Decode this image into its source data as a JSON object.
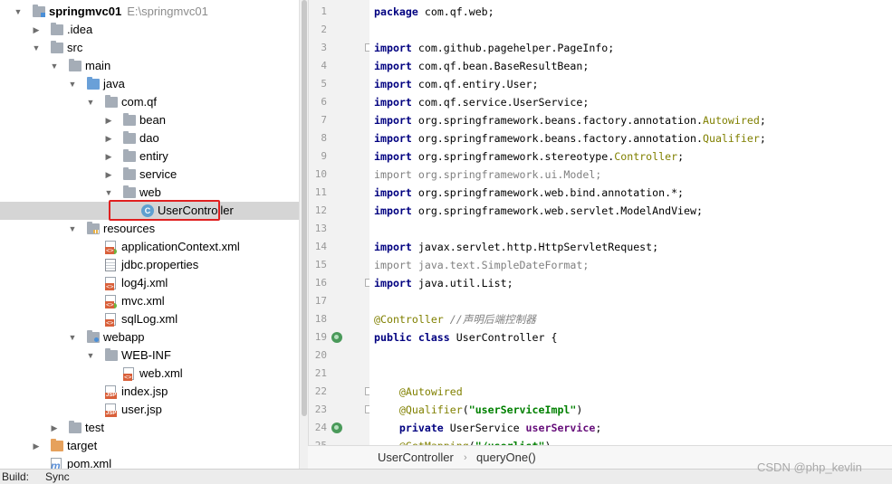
{
  "tree": {
    "rows": [
      {
        "label": "springmvc01",
        "path": "E:\\springmvc01",
        "icon": "module-folder-icon",
        "arrow": "down",
        "depth": 0,
        "bold": true
      },
      {
        "label": ".idea",
        "icon": "folder-icon",
        "arrow": "right",
        "depth": 1
      },
      {
        "label": "src",
        "icon": "folder-icon",
        "arrow": "down",
        "depth": 1
      },
      {
        "label": "main",
        "icon": "folder-icon",
        "arrow": "down",
        "depth": 2
      },
      {
        "label": "java",
        "icon": "source-folder-icon",
        "arrow": "down",
        "depth": 3
      },
      {
        "label": "com.qf",
        "icon": "package-icon",
        "arrow": "down",
        "depth": 4
      },
      {
        "label": "bean",
        "icon": "package-icon",
        "arrow": "right",
        "depth": 5
      },
      {
        "label": "dao",
        "icon": "package-icon",
        "arrow": "right",
        "depth": 5
      },
      {
        "label": "entiry",
        "icon": "package-icon",
        "arrow": "right",
        "depth": 5
      },
      {
        "label": "service",
        "icon": "package-icon",
        "arrow": "right",
        "depth": 5
      },
      {
        "label": "web",
        "icon": "package-icon",
        "arrow": "down",
        "depth": 5
      },
      {
        "label": "UserController",
        "icon": "class-icon",
        "arrow": "",
        "depth": 6,
        "selected": true
      },
      {
        "label": "resources",
        "icon": "resources-folder-icon",
        "arrow": "down",
        "depth": 3
      },
      {
        "label": "applicationContext.xml",
        "icon": "spring-xml-icon",
        "arrow": "",
        "depth": 4
      },
      {
        "label": "jdbc.properties",
        "icon": "properties-file-icon",
        "arrow": "",
        "depth": 4
      },
      {
        "label": "log4j.xml",
        "icon": "xml-file-icon",
        "arrow": "",
        "depth": 4
      },
      {
        "label": "mvc.xml",
        "icon": "spring-xml-icon",
        "arrow": "",
        "depth": 4
      },
      {
        "label": "sqlLog.xml",
        "icon": "xml-file-icon",
        "arrow": "",
        "depth": 4
      },
      {
        "label": "webapp",
        "icon": "web-folder-icon",
        "arrow": "down",
        "depth": 3
      },
      {
        "label": "WEB-INF",
        "icon": "folder-icon",
        "arrow": "down",
        "depth": 4
      },
      {
        "label": "web.xml",
        "icon": "xml-file-icon",
        "arrow": "",
        "depth": 5
      },
      {
        "label": "index.jsp",
        "icon": "jsp-file-icon",
        "arrow": "",
        "depth": 4
      },
      {
        "label": "user.jsp",
        "icon": "jsp-file-icon",
        "arrow": "",
        "depth": 4
      },
      {
        "label": "test",
        "icon": "folder-icon",
        "arrow": "right",
        "depth": 2
      },
      {
        "label": "target",
        "icon": "excluded-folder-icon",
        "arrow": "right",
        "depth": 1
      },
      {
        "label": "pom.xml",
        "icon": "maven-file-icon",
        "arrow": "",
        "depth": 1
      }
    ]
  },
  "editor": {
    "lines": [
      {
        "n": "1",
        "t": [
          {
            "c": "kw",
            "s": "package"
          },
          {
            "c": "",
            "s": " com.qf.web;"
          }
        ]
      },
      {
        "n": "2",
        "t": []
      },
      {
        "n": "3",
        "t": [
          {
            "c": "kw",
            "s": "import"
          },
          {
            "c": "",
            "s": " com.github.pagehelper.PageInfo;"
          }
        ]
      },
      {
        "n": "4",
        "t": [
          {
            "c": "kw",
            "s": "import"
          },
          {
            "c": "",
            "s": " com.qf.bean.BaseResultBean;"
          }
        ]
      },
      {
        "n": "5",
        "t": [
          {
            "c": "kw",
            "s": "import"
          },
          {
            "c": "",
            "s": " com.qf.entiry.User;"
          }
        ]
      },
      {
        "n": "6",
        "t": [
          {
            "c": "kw",
            "s": "import"
          },
          {
            "c": "",
            "s": " com.qf.service.UserService;"
          }
        ]
      },
      {
        "n": "7",
        "t": [
          {
            "c": "kw",
            "s": "import"
          },
          {
            "c": "",
            "s": " org.springframework.beans.factory.annotation."
          },
          {
            "c": "an",
            "s": "Autowired"
          },
          {
            "c": "",
            "s": ";"
          }
        ]
      },
      {
        "n": "8",
        "t": [
          {
            "c": "kw",
            "s": "import"
          },
          {
            "c": "",
            "s": " org.springframework.beans.factory.annotation."
          },
          {
            "c": "an",
            "s": "Qualifier"
          },
          {
            "c": "",
            "s": ";"
          }
        ]
      },
      {
        "n": "9",
        "t": [
          {
            "c": "kw",
            "s": "import"
          },
          {
            "c": "",
            "s": " org.springframework.stereotype."
          },
          {
            "c": "an",
            "s": "Controller"
          },
          {
            "c": "",
            "s": ";"
          }
        ]
      },
      {
        "n": "10",
        "t": [
          {
            "c": "gr",
            "s": "import org.springframework.ui.Model;"
          }
        ]
      },
      {
        "n": "11",
        "t": [
          {
            "c": "kw",
            "s": "import"
          },
          {
            "c": "",
            "s": " org.springframework.web.bind.annotation.*;"
          }
        ]
      },
      {
        "n": "12",
        "t": [
          {
            "c": "kw",
            "s": "import"
          },
          {
            "c": "",
            "s": " org.springframework.web.servlet.ModelAndView;"
          }
        ]
      },
      {
        "n": "13",
        "t": []
      },
      {
        "n": "14",
        "t": [
          {
            "c": "kw",
            "s": "import"
          },
          {
            "c": "",
            "s": " javax.servlet.http.HttpServletRequest;"
          }
        ]
      },
      {
        "n": "15",
        "t": [
          {
            "c": "gr",
            "s": "import java.text.SimpleDateFormat;"
          }
        ]
      },
      {
        "n": "16",
        "t": [
          {
            "c": "kw",
            "s": "import"
          },
          {
            "c": "",
            "s": " java.util.List;"
          }
        ]
      },
      {
        "n": "17",
        "t": []
      },
      {
        "n": "18",
        "t": [
          {
            "c": "an",
            "s": "@Controller"
          },
          {
            "c": "",
            "s": " "
          },
          {
            "c": "cm",
            "s": "//声明后端控制器"
          }
        ]
      },
      {
        "n": "19",
        "t": [
          {
            "c": "kw",
            "s": "public class"
          },
          {
            "c": "",
            "s": " UserController {"
          }
        ]
      },
      {
        "n": "20",
        "t": []
      },
      {
        "n": "21",
        "t": []
      },
      {
        "n": "22",
        "t": [
          {
            "c": "",
            "s": "    "
          },
          {
            "c": "an",
            "s": "@Autowired"
          }
        ]
      },
      {
        "n": "23",
        "t": [
          {
            "c": "",
            "s": "    "
          },
          {
            "c": "an",
            "s": "@Qualifier"
          },
          {
            "c": "",
            "s": "("
          },
          {
            "c": "st",
            "s": "\"userServiceImpl\""
          },
          {
            "c": "",
            "s": ")"
          }
        ]
      },
      {
        "n": "24",
        "t": [
          {
            "c": "",
            "s": "    "
          },
          {
            "c": "kw",
            "s": "private"
          },
          {
            "c": "",
            "s": " UserService "
          },
          {
            "c": "fd",
            "s": "userService"
          },
          {
            "c": "",
            "s": ";"
          }
        ]
      },
      {
        "n": "25",
        "t": [
          {
            "c": "",
            "s": "    "
          },
          {
            "c": "an",
            "s": "@GetMapping"
          },
          {
            "c": "",
            "s": "("
          },
          {
            "c": "st",
            "s": "\"/userlist\""
          },
          {
            "c": "",
            "s": ")"
          }
        ]
      }
    ]
  },
  "breadcrumb": {
    "class_name": "UserController",
    "separator": "›",
    "method": "queryOne()"
  },
  "bottom": {
    "build_label": "Build:",
    "sync_label": "Sync"
  },
  "watermark": "CSDN @php_kevlin"
}
